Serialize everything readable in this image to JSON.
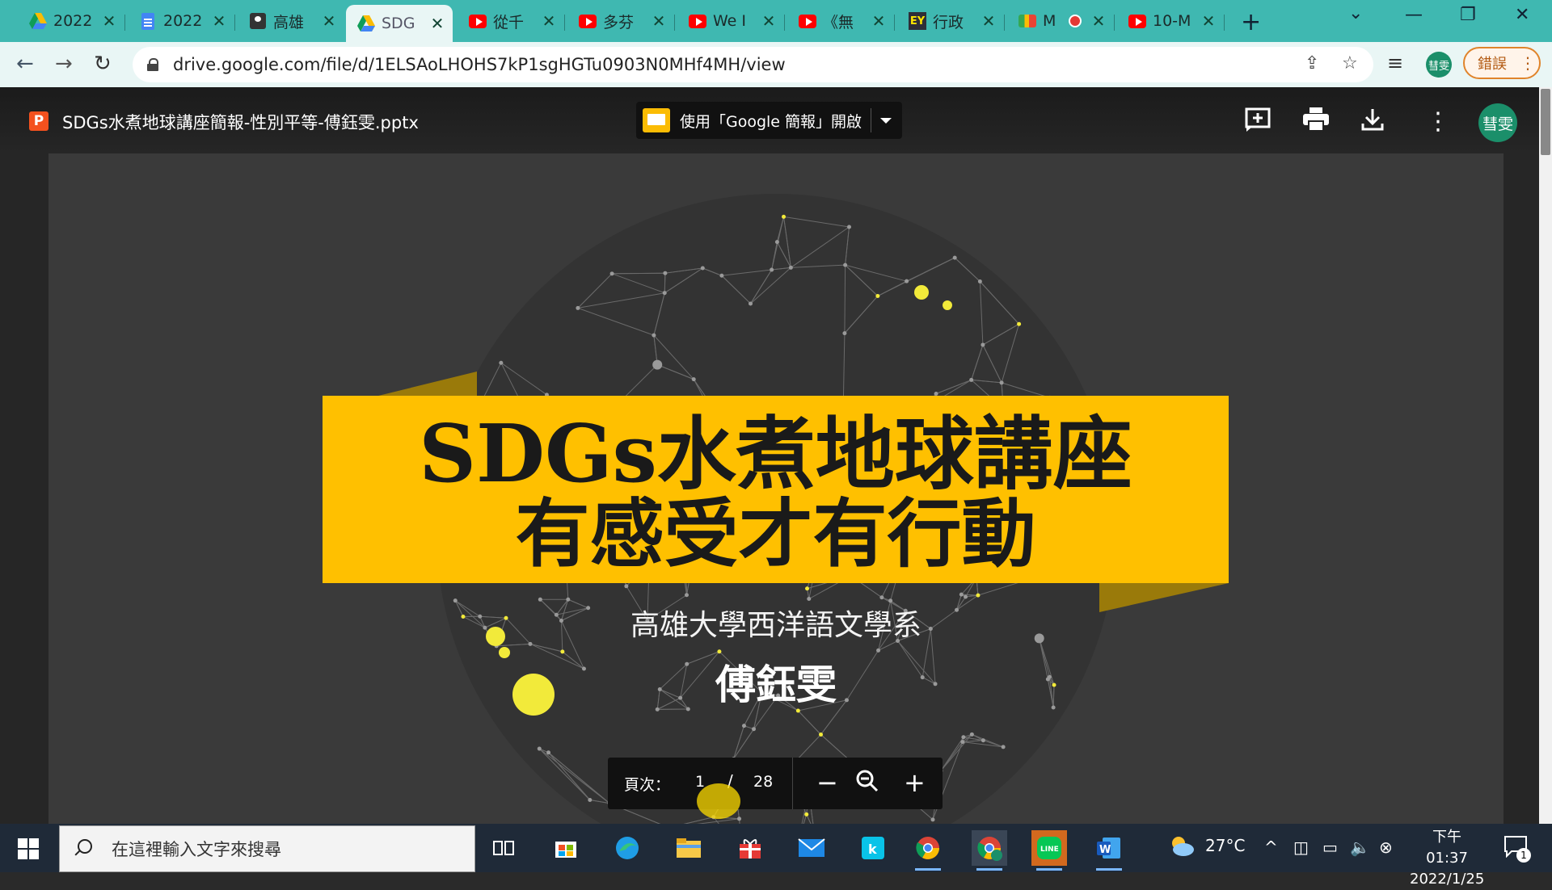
{
  "browser": {
    "tabs": [
      {
        "title": "2022",
        "icon": "google-drive-icon"
      },
      {
        "title": "2022",
        "icon": "google-docs-icon"
      },
      {
        "title": "高雄",
        "icon": "contacts-icon"
      },
      {
        "title": "SDG",
        "icon": "google-drive-icon",
        "active": true
      },
      {
        "title": "從千",
        "icon": "youtube-icon"
      },
      {
        "title": "多芬",
        "icon": "youtube-icon"
      },
      {
        "title": "We I",
        "icon": "youtube-icon"
      },
      {
        "title": "《無",
        "icon": "youtube-icon"
      },
      {
        "title": "行政",
        "icon": "ey-icon"
      },
      {
        "title": "M",
        "icon": "google-meet-icon"
      },
      {
        "title": "10-M",
        "icon": "youtube-icon"
      }
    ],
    "url": "drive.google.com/file/d/1ELSAoLHOHS7kP1sgHGTu0903N0MHf4MH/view",
    "profile_initials": "彗雯",
    "error_button": "錯誤"
  },
  "viewer": {
    "file_name": "SDGs水煮地球講座簡報-性別平等-傅鈺雯.pptx",
    "open_with_label": "使用「Google 簡報」開啟",
    "avatar_initials": "彗雯",
    "page_label": "頁次：",
    "current_page": "1",
    "page_separator": "/",
    "total_pages": "28"
  },
  "slide": {
    "title_line1": "SDGs水煮地球講座",
    "title_line2": "有感受才有行動",
    "subtitle": "高雄大學西洋語文學系",
    "author": "傅鈺雯",
    "accent_color": "#ffc000",
    "background_color": "#3a3a3a"
  },
  "taskbar": {
    "search_placeholder": "在這裡輸入文字來搜尋",
    "temperature": "27°C",
    "time": "下午 01:37",
    "date": "2022/1/25",
    "notification_count": "1"
  }
}
